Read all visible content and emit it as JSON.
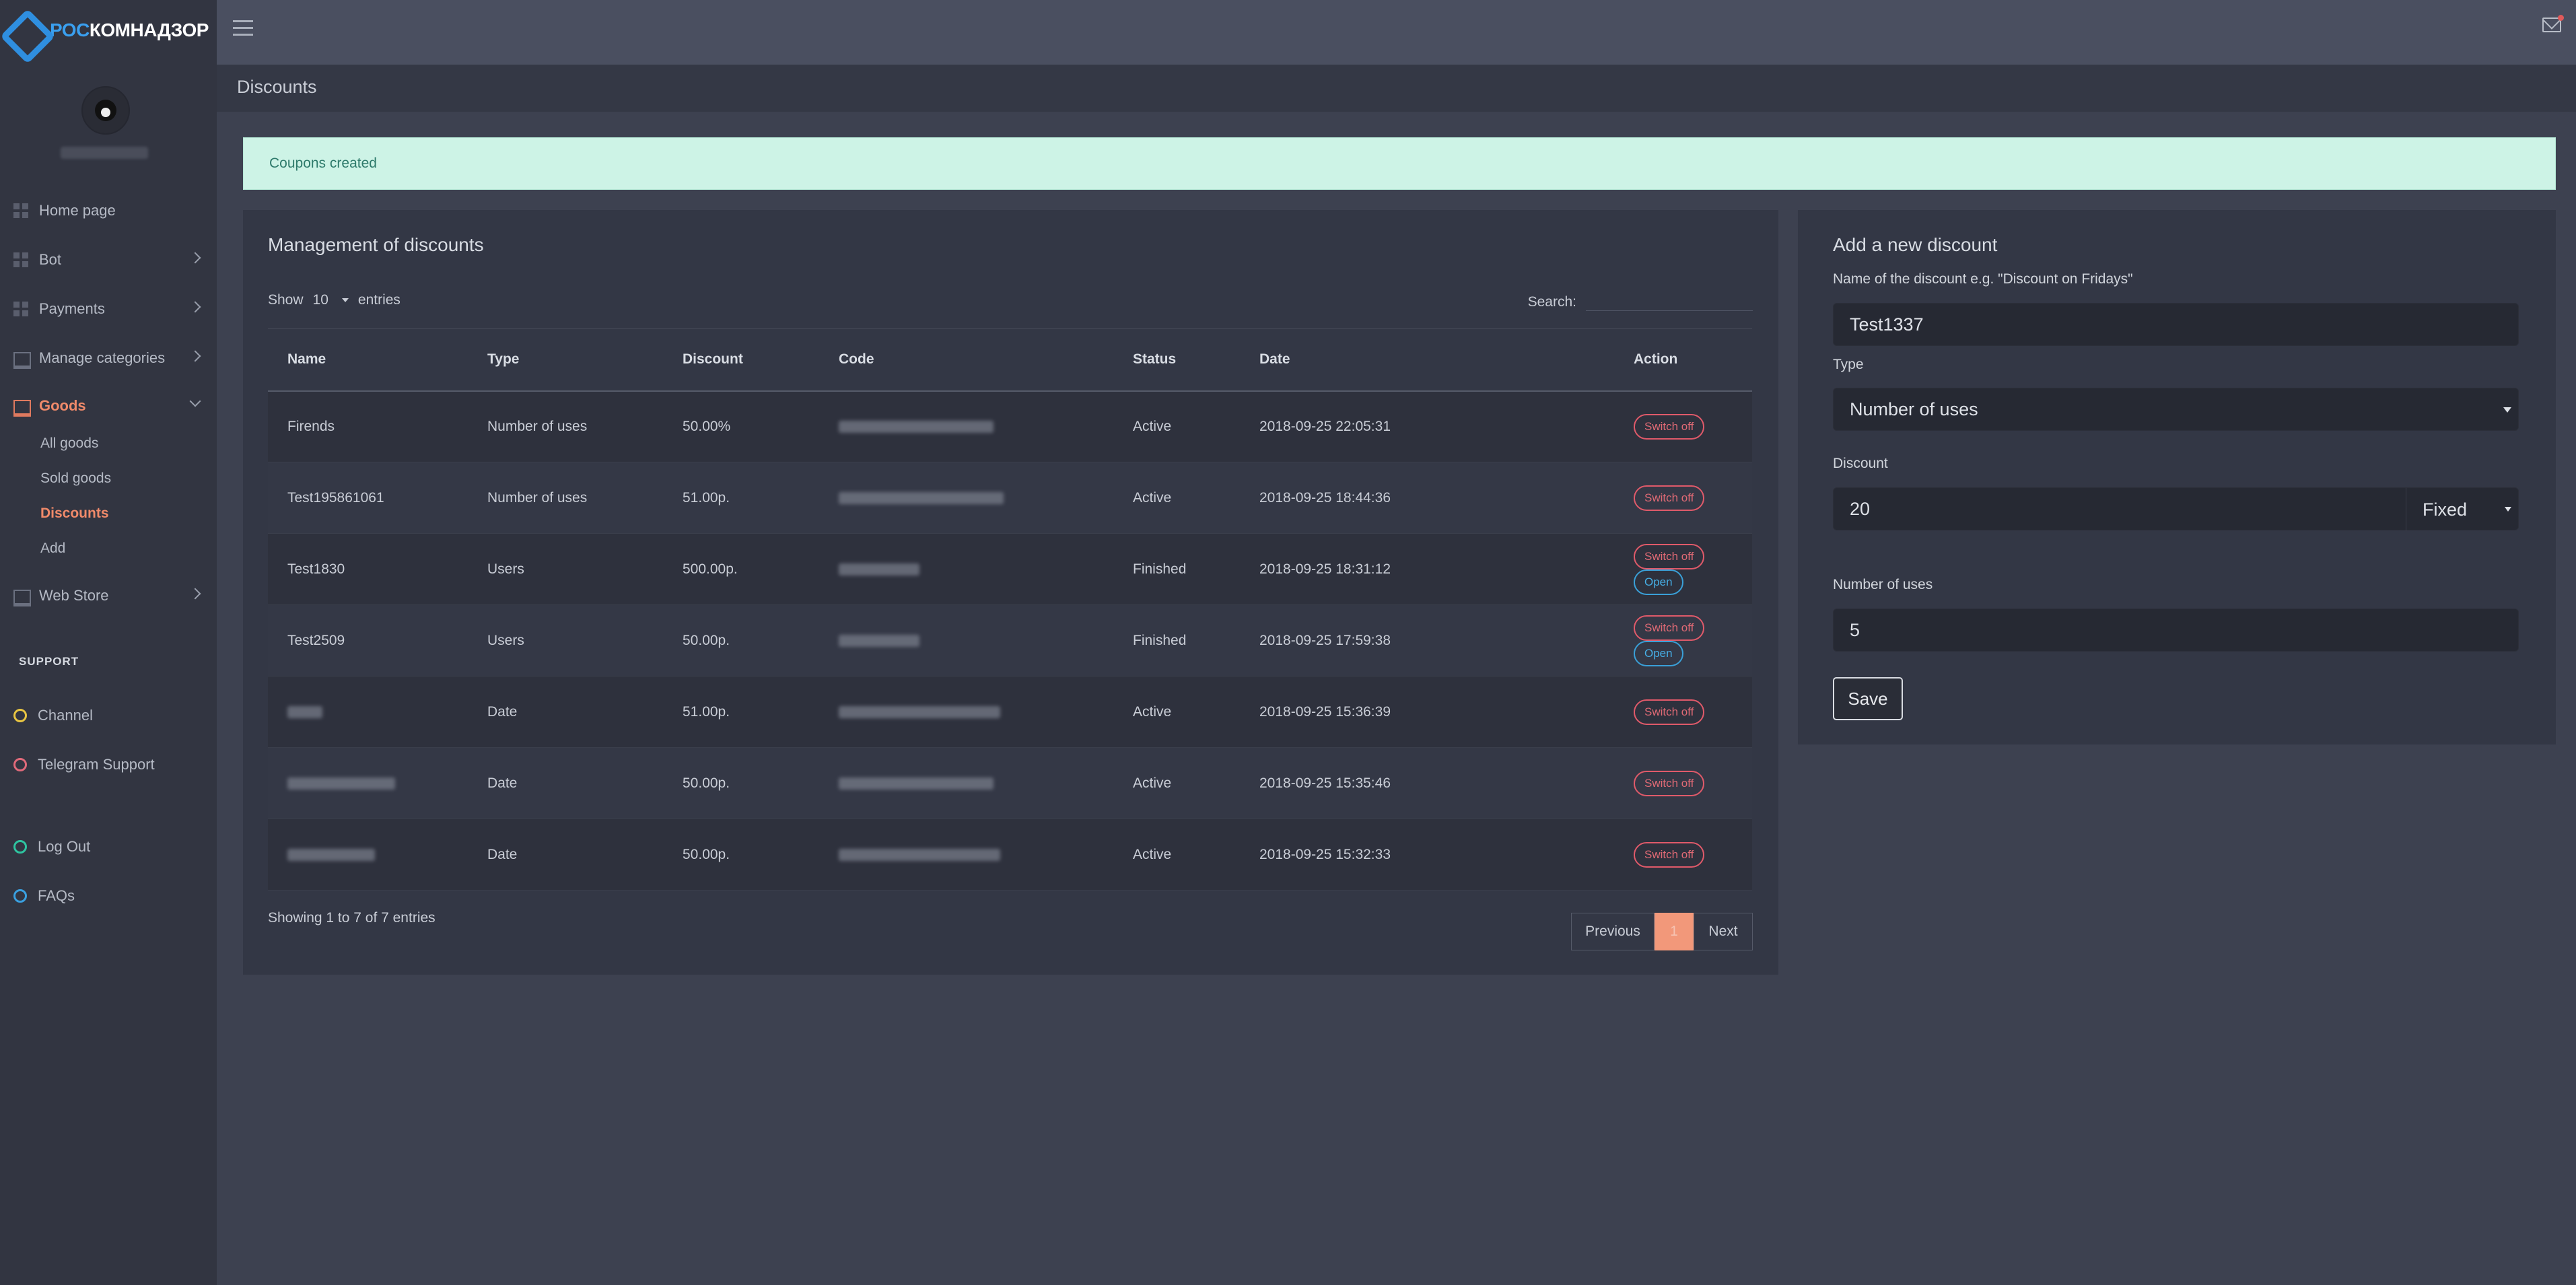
{
  "brand": {
    "part1": "РОС",
    "part2": "КОМНАДЗОР"
  },
  "sidebar": {
    "items": [
      {
        "label": "Home page"
      },
      {
        "label": "Bot"
      },
      {
        "label": "Payments"
      },
      {
        "label": "Manage categories"
      },
      {
        "label": "Goods"
      },
      {
        "label": "Web Store"
      }
    ],
    "goods_sub": [
      {
        "label": "All goods"
      },
      {
        "label": "Sold goods"
      },
      {
        "label": "Discounts"
      },
      {
        "label": "Add"
      }
    ],
    "support_label": "SUPPORT",
    "support_items": [
      {
        "label": "Channel",
        "color": "#e8c542"
      },
      {
        "label": "Telegram Support",
        "color": "#e06a7a"
      }
    ],
    "bottom_items": [
      {
        "label": "Log Out",
        "color": "#2ec4a0"
      },
      {
        "label": "FAQs",
        "color": "#3aa0e0"
      }
    ]
  },
  "page": {
    "title": "Discounts"
  },
  "alert": {
    "text": "Coupons created"
  },
  "table_panel": {
    "title": "Management of discounts",
    "show_label": "Show",
    "show_value": "10",
    "entries_label": "entries",
    "search_label": "Search:",
    "columns": [
      "Name",
      "Type",
      "Discount",
      "Code",
      "Status",
      "Date",
      "Action"
    ],
    "rows": [
      {
        "name": "Firends",
        "type": "Number of uses",
        "discount": "50.00%",
        "status": "Active",
        "date": "2018-09-25 22:05:31",
        "switch": "Switch off",
        "open": ""
      },
      {
        "name": "Test195861061",
        "type": "Number of uses",
        "discount": "51.00p.",
        "status": "Active",
        "date": "2018-09-25 18:44:36",
        "switch": "Switch off",
        "open": ""
      },
      {
        "name": "Test1830",
        "type": "Users",
        "discount": "500.00p.",
        "status": "Finished",
        "date": "2018-09-25 18:31:12",
        "switch": "Switch off",
        "open": "Open"
      },
      {
        "name": "Test2509",
        "type": "Users",
        "discount": "50.00p.",
        "status": "Finished",
        "date": "2018-09-25 17:59:38",
        "switch": "Switch off",
        "open": "Open"
      },
      {
        "name": "",
        "type": "Date",
        "discount": "51.00p.",
        "status": "Active",
        "date": "2018-09-25 15:36:39",
        "switch": "Switch off",
        "open": ""
      },
      {
        "name": "",
        "type": "Date",
        "discount": "50.00p.",
        "status": "Active",
        "date": "2018-09-25 15:35:46",
        "switch": "Switch off",
        "open": ""
      },
      {
        "name": "",
        "type": "Date",
        "discount": "50.00p.",
        "status": "Active",
        "date": "2018-09-25 15:32:33",
        "switch": "Switch off",
        "open": ""
      }
    ],
    "info": "Showing 1 to 7 of 7 entries",
    "pagination": {
      "prev": "Previous",
      "page": "1",
      "next": "Next"
    }
  },
  "form_panel": {
    "title": "Add a new discount",
    "name_label": "Name of the discount e.g. \"Discount on Fridays\"",
    "name_value": "Test1337",
    "type_label": "Type",
    "type_value": "Number of uses",
    "discount_label": "Discount",
    "discount_value": "20",
    "discount_kind": "Fixed",
    "uses_label": "Number of uses",
    "uses_value": "5",
    "save_label": "Save"
  },
  "colors": {
    "accent": "#f08a6a",
    "switch_off": "#e05a6a",
    "open": "#3aa0d8",
    "alert_bg": "#cdf3e6"
  }
}
